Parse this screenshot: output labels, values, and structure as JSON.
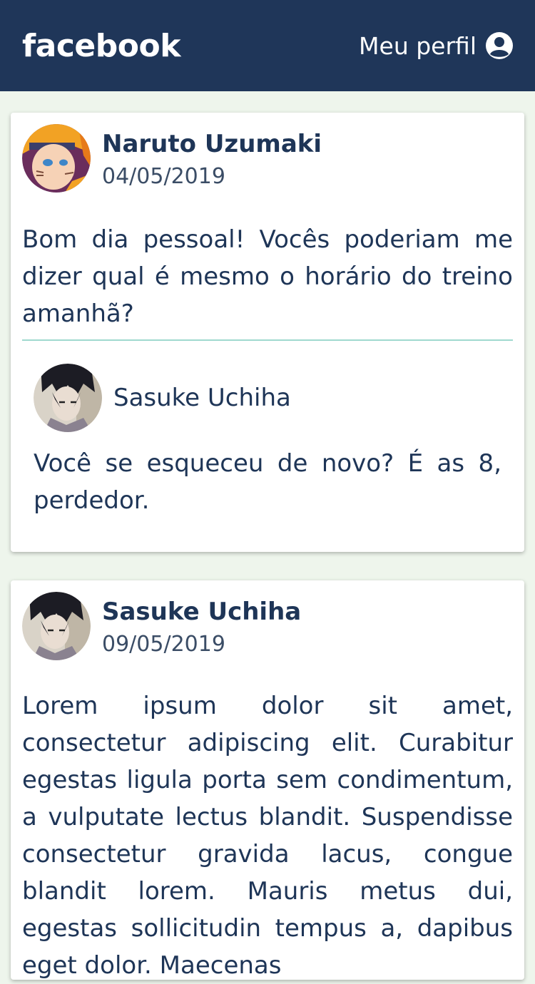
{
  "header": {
    "logo": "facebook",
    "profile_label": "Meu perfil",
    "profile_icon": "user-circle-icon",
    "background_color": "#1f3659"
  },
  "posts": [
    {
      "author": "Naruto Uzumaki",
      "date": "04/05/2019",
      "avatar": "naruto-avatar",
      "text": "Bom dia pessoal! Vocês poderiam me dizer qual é mesmo o horário do treino amanhã?",
      "comments": [
        {
          "author": "Sasuke Uchiha",
          "avatar": "sasuke-avatar",
          "text": "Você se esqueceu de novo? É as 8, perdedor."
        }
      ]
    },
    {
      "author": "Sasuke Uchiha",
      "date": "09/05/2019",
      "avatar": "sasuke-avatar",
      "text": "Lorem ipsum dolor sit amet, consectetur adipiscing elit. Curabitur egestas ligula porta sem condimentum, a vulputate lectus blandit. Suspendisse consectetur gravida lacus, congue blandit lorem. Mauris metus dui, egestas sollicitudin tempus a, dapibus eget dolor. Maecenas"
    }
  ],
  "colors": {
    "page_background": "#eef5ec",
    "text": "#1e3557",
    "divider": "#9fd9cf"
  }
}
